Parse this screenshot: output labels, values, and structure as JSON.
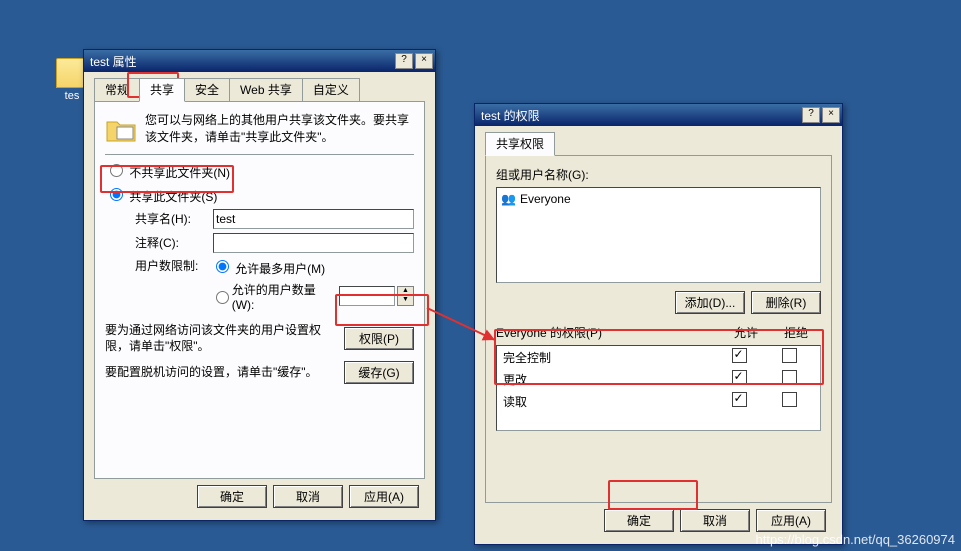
{
  "desktop": {
    "folder_label": "tes"
  },
  "win1": {
    "title": "test 属性",
    "tabs": {
      "general": "常规",
      "share": "共享",
      "security": "安全",
      "webshare": "Web 共享",
      "custom": "自定义"
    },
    "hint": "您可以与网络上的其他用户共享该文件夹。要共享该文件夹，请单击\"共享此文件夹\"。",
    "radio_noshare": "不共享此文件夹(N)",
    "radio_share": "共享此文件夹(S)",
    "sharename_lbl": "共享名(H):",
    "sharename_val": "test",
    "comment_lbl": "注释(C):",
    "comment_val": "",
    "limit_lbl": "用户数限制:",
    "limit_max": "允许最多用户(M)",
    "limit_num": "允许的用户数量(W):",
    "perm_hint": "要为通过网络访问该文件夹的用户设置权限，请单击\"权限\"。",
    "cache_hint": "要配置脱机访问的设置，请单击\"缓存\"。",
    "perm_btn": "权限(P)",
    "cache_btn": "缓存(G)",
    "ok": "确定",
    "cancel": "取消",
    "apply": "应用(A)"
  },
  "win2": {
    "title": "test 的权限",
    "tab": "共享权限",
    "group_lbl": "组或用户名称(G):",
    "users": [
      "Everyone"
    ],
    "add_btn": "添加(D)...",
    "remove_btn": "删除(R)",
    "perm_for": "Everyone 的权限(P)",
    "col_allow": "允许",
    "col_deny": "拒绝",
    "perms": [
      {
        "name": "完全控制",
        "allow": true,
        "deny": false
      },
      {
        "name": "更改",
        "allow": true,
        "deny": false
      },
      {
        "name": "读取",
        "allow": true,
        "deny": false
      }
    ],
    "ok": "确定",
    "cancel": "取消",
    "apply": "应用(A)"
  },
  "watermark": "https://blog.csdn.net/qq_36260974"
}
